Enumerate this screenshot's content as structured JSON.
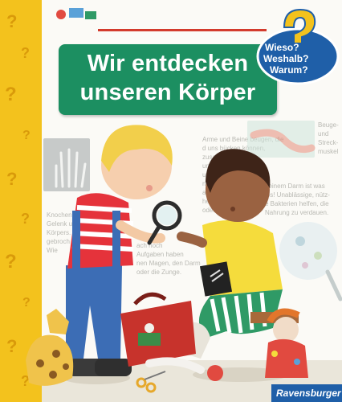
{
  "series_badge": {
    "line1": "Wieso?",
    "line2": "Weshalb?",
    "line3": "Warum?"
  },
  "title": {
    "line1": "Wir entdecken",
    "line2": "unseren Körper"
  },
  "background_text": {
    "col_left": [
      "Knochen und",
      "Gelenk umge",
      "Körpers. A",
      "gebroch",
      "Wie"
    ],
    "col_mid": [
      "Arme und Beine beugen, die",
      "d uns bücken können,",
      "zusammen",
      "und Muskel",
      "umen",
      "nden w",
      "agen oder di",
      "hen oder Luft",
      "oder",
      "ach noch",
      "Aufgaben haben",
      "nen Magen, den Darm",
      "oder die Zunge."
    ],
    "col_right": [
      "deinem Darm ist was",
      "los! Unablässige, nütz-",
      "e Bakterien helfen, die",
      "Nahrung zu verdauen."
    ],
    "corner_right": [
      "Beuge-",
      "und",
      "Streck-",
      "muskel"
    ]
  },
  "publisher": "Ravensburger",
  "colors": {
    "spine": "#f3c21d",
    "title_box": "#1c8f61",
    "badge": "#1f5fa8",
    "publisher_bar": "#1f5fa8"
  }
}
